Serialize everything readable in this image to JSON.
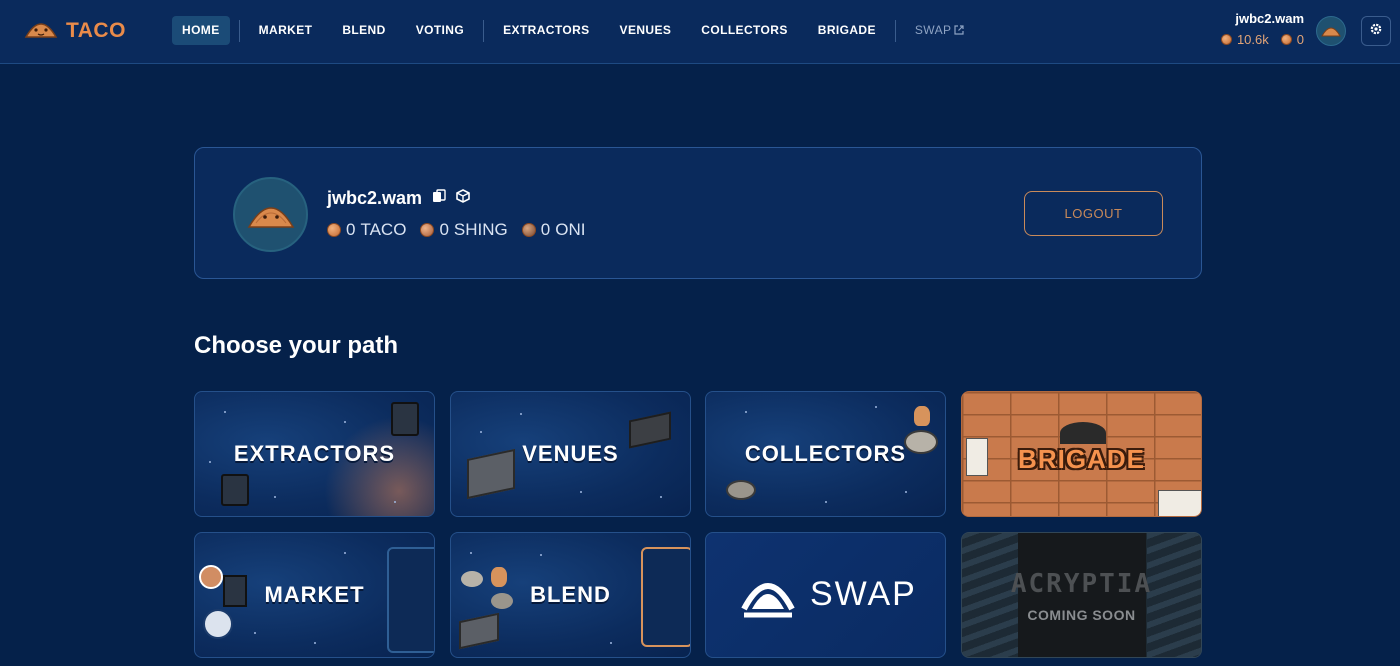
{
  "brand": {
    "name": "TACO",
    "logo_icon": "taco-logo-icon"
  },
  "nav": {
    "items": [
      {
        "label": "HOME",
        "active": true
      },
      {
        "label": "MARKET"
      },
      {
        "label": "BLEND"
      },
      {
        "label": "VOTING"
      },
      {
        "label": "EXTRACTORS"
      },
      {
        "label": "VENUES"
      },
      {
        "label": "COLLECTORS"
      },
      {
        "label": "BRIGADE"
      }
    ],
    "swap": {
      "label": "SWAP",
      "icon": "external-link-icon"
    }
  },
  "account": {
    "name": "jwbc2.wam",
    "balances": [
      {
        "icon": "taco-coin-icon",
        "value": "10.6k"
      },
      {
        "icon": "coin-icon",
        "value": "0"
      }
    ]
  },
  "profile": {
    "name": "jwbc2.wam",
    "badges": [
      "card-stack-icon",
      "cube-icon"
    ],
    "balances": [
      {
        "icon": "taco-coin-icon",
        "value": "0",
        "unit": "TACO"
      },
      {
        "icon": "shing-coin-icon",
        "value": "0",
        "unit": "SHING"
      },
      {
        "icon": "oni-coin-icon",
        "value": "0",
        "unit": "ONI"
      }
    ],
    "logout_label": "LOGOUT"
  },
  "paths": {
    "title": "Choose your path",
    "tiles": [
      {
        "label": "EXTRACTORS"
      },
      {
        "label": "VENUES"
      },
      {
        "label": "COLLECTORS"
      },
      {
        "label": "BRIGADE"
      },
      {
        "label": "MARKET"
      },
      {
        "label": "BLEND"
      },
      {
        "label": "SWAP"
      },
      {
        "label": "ACRYPTIA",
        "sub": "COMING SOON"
      }
    ]
  },
  "colors": {
    "background": "#05214a",
    "panel": "#0a2a5c",
    "accent": "#e98b4a",
    "logout": "#c98a5a"
  }
}
